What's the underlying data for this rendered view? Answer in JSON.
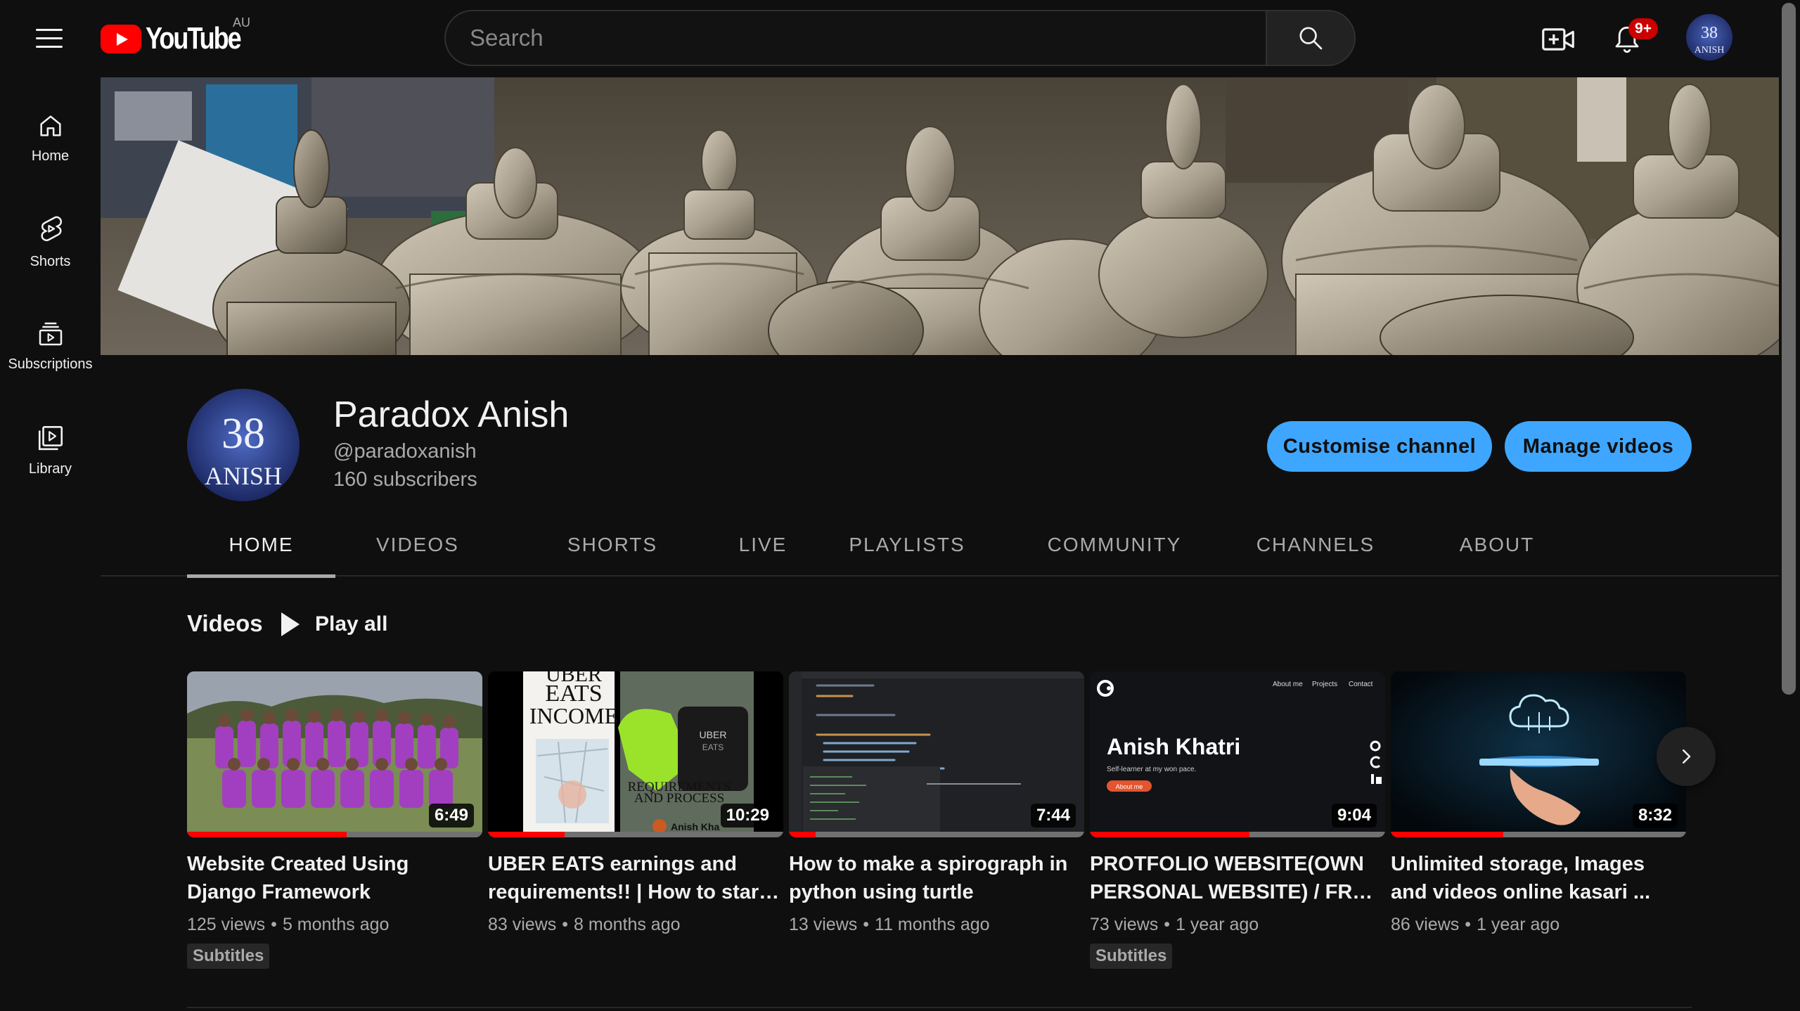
{
  "header": {
    "logo_text": "YouTube",
    "region": "AU",
    "search_placeholder": "Search",
    "notification_count": "9+",
    "avatar_text_top": "38",
    "avatar_text_bottom": "ANISH"
  },
  "sidebar": {
    "items": [
      {
        "label": "Home",
        "icon": "home-icon"
      },
      {
        "label": "Shorts",
        "icon": "shorts-icon"
      },
      {
        "label": "Subscriptions",
        "icon": "subscriptions-icon"
      },
      {
        "label": "Library",
        "icon": "library-icon"
      }
    ]
  },
  "channel": {
    "name": "Paradox Anish",
    "handle": "@paradoxanish",
    "subscribers": "160 subscribers",
    "customise_label": "Customise channel",
    "manage_label": "Manage videos"
  },
  "tabs": [
    "HOME",
    "VIDEOS",
    "SHORTS",
    "LIVE",
    "PLAYLISTS",
    "COMMUNITY",
    "CHANNELS",
    "ABOUT"
  ],
  "active_tab": "HOME",
  "section": {
    "title": "Videos",
    "play_all": "Play all"
  },
  "videos": [
    {
      "title": "Website Created Using Django Framework",
      "duration": "6:49",
      "views": "125 views",
      "age": "5 months ago",
      "badge": "Subtitles",
      "progress": 0.54
    },
    {
      "title": "UBER EATS earnings and requirements!! | How to start ...",
      "duration": "10:29",
      "views": "83 views",
      "age": "8 months ago",
      "badge": "",
      "progress": 0.26,
      "thumb_text": {
        "line1": "UBER",
        "line2": "EATS",
        "line3": "INCOME",
        "bag": "UBER",
        "bag2": "EATS",
        "req1": "REQUIREMENTS",
        "req2": "AND PROCESS",
        "author": "Anish Kha"
      }
    },
    {
      "title": "How to make a spirograph in python using turtle",
      "duration": "7:44",
      "views": "13 views",
      "age": "11 months ago",
      "badge": "",
      "progress": 0.09
    },
    {
      "title": "PROTFOLIO WEBSITE(OWN PERSONAL WEBSITE) / FREE ...",
      "duration": "9:04",
      "views": "73 views",
      "age": "1 year ago",
      "badge": "Subtitles",
      "progress": 0.54,
      "thumb_text": {
        "nav1": "About me",
        "nav2": "Projects",
        "nav3": "Contact",
        "name": "Anish Khatri",
        "tagline": "Self-learner at my won pace.",
        "btn": "About me"
      }
    },
    {
      "title": "Unlimited storage, Images and videos online kasari ...",
      "duration": "8:32",
      "views": "86 views",
      "age": "1 year ago",
      "badge": "",
      "progress": 0.38
    }
  ],
  "colors": {
    "accent_blue": "#3ea6ff",
    "progress_red": "#ff0000",
    "brand_red": "#ff0000",
    "badge_red": "#cc0000",
    "background": "#0f0f0f"
  }
}
